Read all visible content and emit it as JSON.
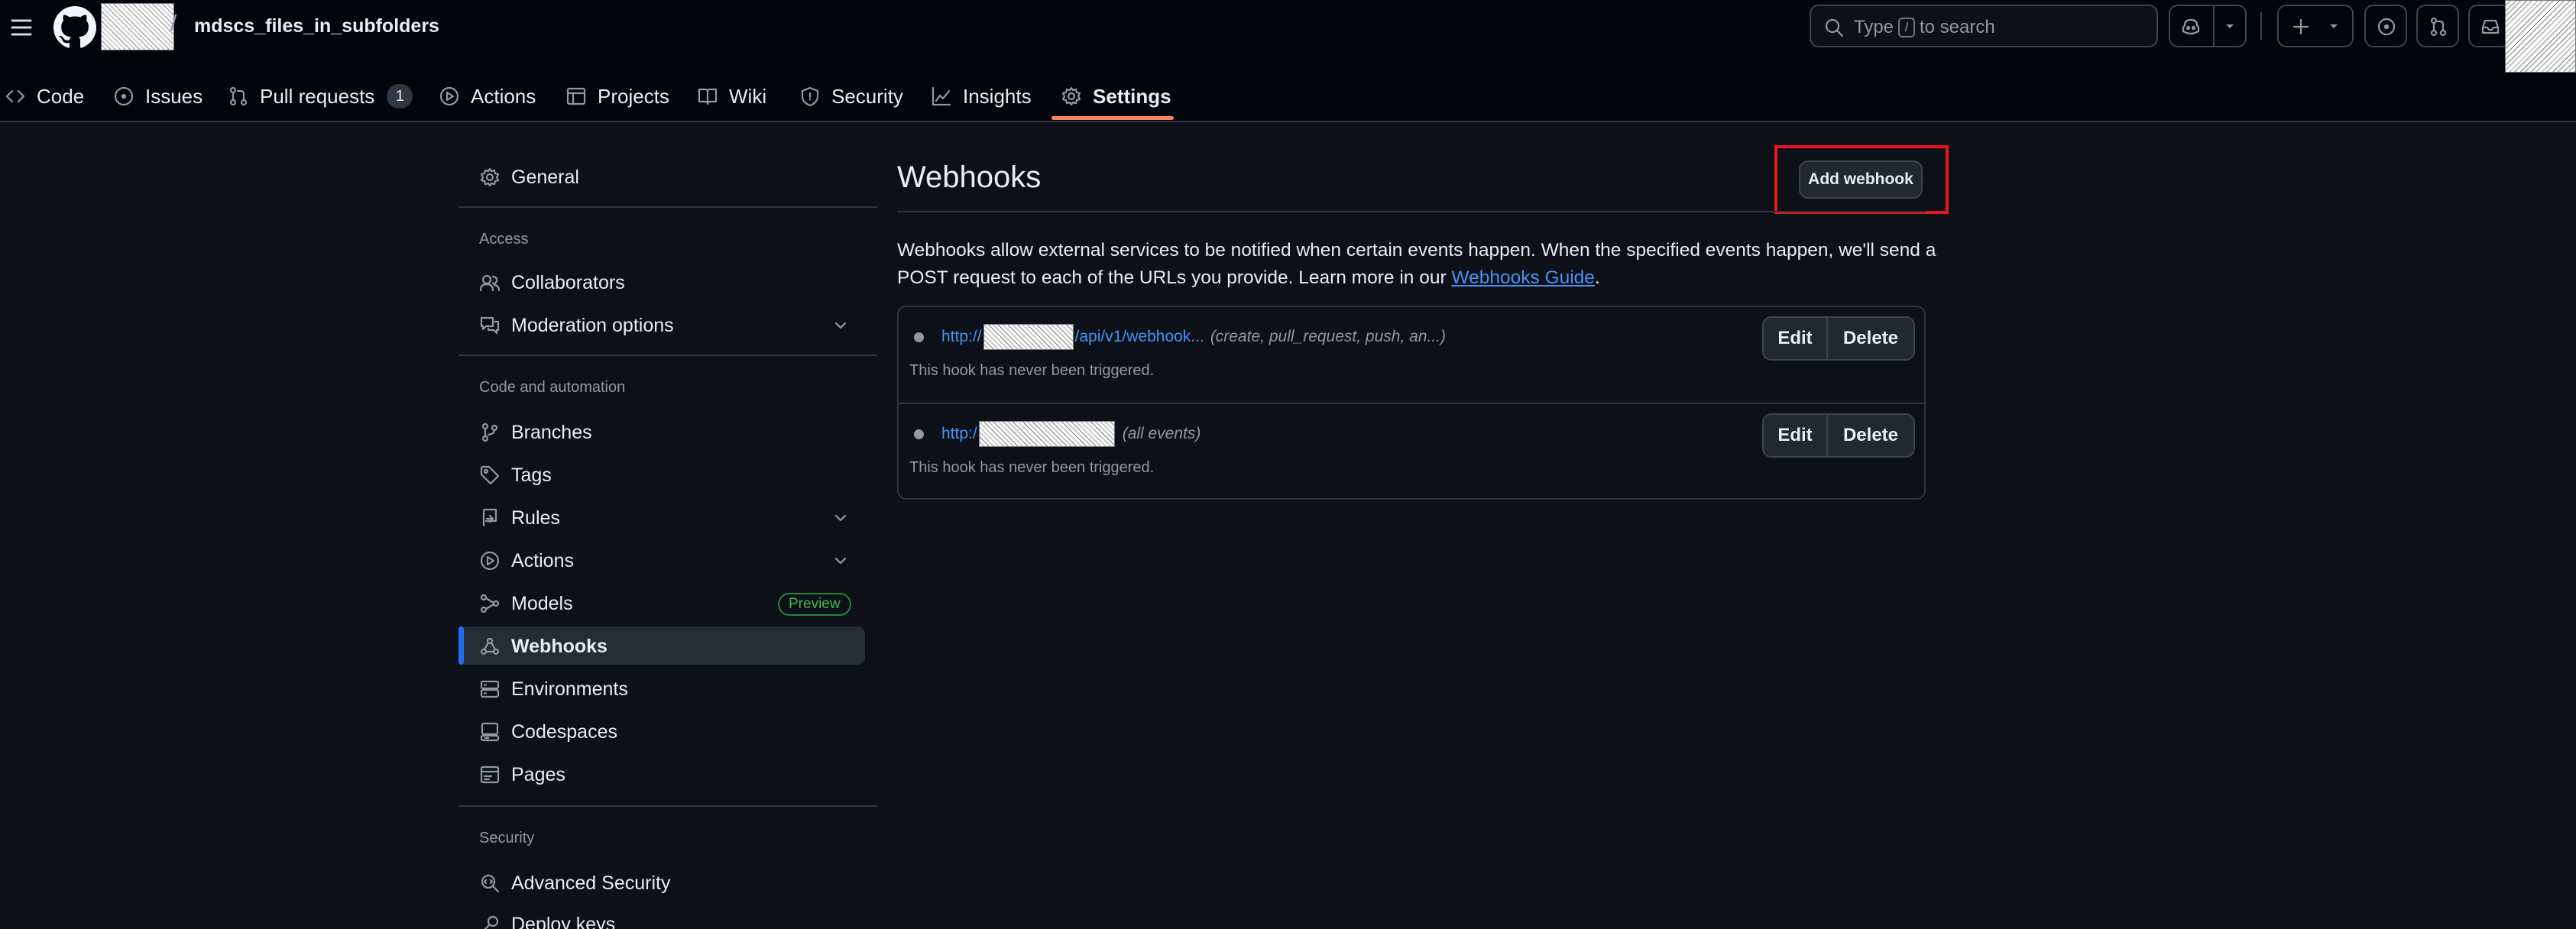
{
  "header": {
    "path_separator": "/",
    "repo_name": "mdscs_files_in_subfolders",
    "search": {
      "prefix": "Type",
      "key": "/",
      "suffix": "to search"
    }
  },
  "repo_nav": {
    "tabs": [
      {
        "label": "Code",
        "icon": "code-icon"
      },
      {
        "label": "Issues",
        "icon": "issue-icon"
      },
      {
        "label": "Pull requests",
        "icon": "pull-request-icon",
        "count": "1"
      },
      {
        "label": "Actions",
        "icon": "play-icon"
      },
      {
        "label": "Projects",
        "icon": "table-icon"
      },
      {
        "label": "Wiki",
        "icon": "book-icon"
      },
      {
        "label": "Security",
        "icon": "shield-icon"
      },
      {
        "label": "Insights",
        "icon": "graph-icon"
      },
      {
        "label": "Settings",
        "icon": "gear-icon",
        "active": true
      }
    ]
  },
  "sidebar": {
    "general": "General",
    "access_heading": "Access",
    "collaborators": "Collaborators",
    "moderation": "Moderation options",
    "code_heading": "Code and automation",
    "branches": "Branches",
    "tags": "Tags",
    "rules": "Rules",
    "actions": "Actions",
    "models": "Models",
    "models_badge": "Preview",
    "webhooks": "Webhooks",
    "environments": "Environments",
    "codespaces": "Codespaces",
    "pages": "Pages",
    "security_heading": "Security",
    "advanced_security": "Advanced Security",
    "deploy_keys": "Deploy keys"
  },
  "main": {
    "title": "Webhooks",
    "add_button": "Add webhook",
    "description": "Webhooks allow external services to be notified when certain events happen. When the specified events happen, we'll send a POST request to each of the URLs you provide. Learn more in our",
    "guide_link": "Webhooks Guide",
    "period": ".",
    "hooks": [
      {
        "url_prefix": "http://",
        "url_suffix": "/api/v1/webhook...",
        "events": "(create, pull_request, push, an...)",
        "status": "This hook has never been triggered."
      },
      {
        "url_prefix": "http:/",
        "url_suffix": "",
        "events": "(all events)",
        "status": "This hook has never been triggered."
      }
    ],
    "edit_label": "Edit",
    "delete_label": "Delete"
  },
  "colors": {
    "background": "#0d1117",
    "header_bg": "#010409",
    "link": "#4493f8",
    "active_tab_underline": "#f78166",
    "active_sidebar_bar": "#1f6feb",
    "highlight_box": "#e5161f",
    "preview_badge": "#3fb950"
  }
}
